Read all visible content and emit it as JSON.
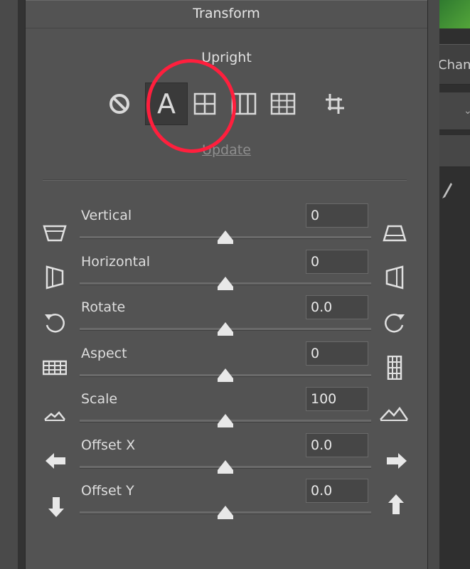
{
  "panel": {
    "title": "Transform"
  },
  "upright": {
    "label": "Upright",
    "buttons": [
      {
        "name": "off",
        "icon": "no-symbol-icon"
      },
      {
        "name": "auto",
        "icon": "letter-a-icon",
        "glyph": "A",
        "active": true
      },
      {
        "name": "level",
        "icon": "level-grid-icon"
      },
      {
        "name": "vertical",
        "icon": "vertical-grid-icon"
      },
      {
        "name": "full",
        "icon": "full-grid-icon"
      },
      {
        "name": "guided",
        "icon": "crop-guide-icon"
      }
    ],
    "update_label": "Update"
  },
  "sliders": [
    {
      "label": "Vertical",
      "value": "0",
      "position": 0.5,
      "left_icon": "keystone-vertical-minus-icon",
      "right_icon": "keystone-vertical-plus-icon"
    },
    {
      "label": "Horizontal",
      "value": "0",
      "position": 0.5,
      "left_icon": "keystone-horizontal-minus-icon",
      "right_icon": "keystone-horizontal-plus-icon"
    },
    {
      "label": "Rotate",
      "value": "0.0",
      "position": 0.5,
      "left_icon": "rotate-ccw-icon",
      "right_icon": "rotate-cw-icon"
    },
    {
      "label": "Aspect",
      "value": "0",
      "position": 0.5,
      "left_icon": "aspect-wide-icon",
      "right_icon": "aspect-tall-icon"
    },
    {
      "label": "Scale",
      "value": "100",
      "position": 0.5,
      "left_icon": "scale-small-icon",
      "right_icon": "scale-large-icon"
    },
    {
      "label": "Offset X",
      "value": "0.0",
      "position": 0.5,
      "left_icon": "arrow-left-icon",
      "right_icon": "arrow-right-icon"
    },
    {
      "label": "Offset Y",
      "value": "0.0",
      "position": 0.5,
      "left_icon": "arrow-down-icon",
      "right_icon": "arrow-up-icon"
    }
  ],
  "right_panel": {
    "tab_label": "Channe"
  },
  "colors": {
    "annotation": "#ff1f3d",
    "panel_bg": "#535353"
  }
}
